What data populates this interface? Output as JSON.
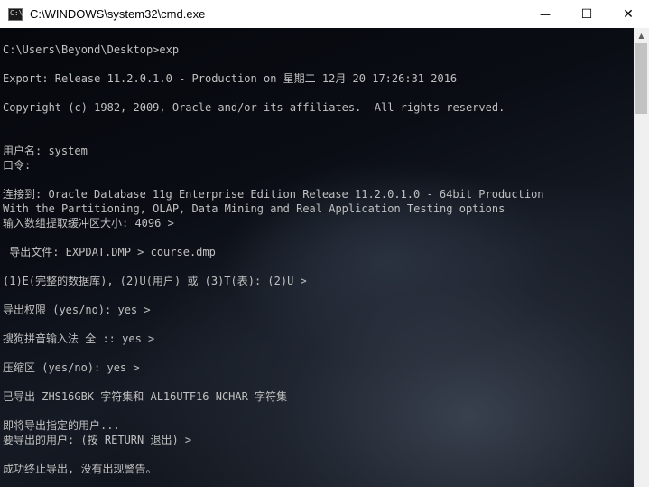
{
  "window": {
    "title": "C:\\WINDOWS\\system32\\cmd.exe",
    "icon_label": "C:\\",
    "controls": {
      "minimize": "—",
      "maximize": "☐",
      "close": "✕"
    }
  },
  "console": {
    "lines": [
      "",
      "C:\\Users\\Beyond\\Desktop>exp",
      "",
      "Export: Release 11.2.0.1.0 - Production on 星期二 12月 20 17:26:31 2016",
      "",
      "Copyright (c) 1982, 2009, Oracle and/or its affiliates.  All rights reserved.",
      "",
      "",
      "用户名: system",
      "口令:",
      "",
      "连接到: Oracle Database 11g Enterprise Edition Release 11.2.0.1.0 - 64bit Production",
      "With the Partitioning, OLAP, Data Mining and Real Application Testing options",
      "输入数组提取缓冲区大小: 4096 >",
      "",
      " 导出文件: EXPDAT.DMP > course.dmp",
      "",
      "(1)E(完整的数据库), (2)U(用户) 或 (3)T(表): (2)U >",
      "",
      "导出权限 (yes/no): yes >",
      "",
      "搜狗拼音输入法 全 :: yes >",
      "",
      "压缩区 (yes/no): yes >",
      "",
      "已导出 ZHS16GBK 字符集和 AL16UTF16 NCHAR 字符集",
      "",
      "即将导出指定的用户...",
      "要导出的用户: (按 RETURN 退出) >",
      "",
      "成功终止导出, 没有出现警告。"
    ]
  },
  "scrollbar": {
    "up_arrow": "▲"
  }
}
